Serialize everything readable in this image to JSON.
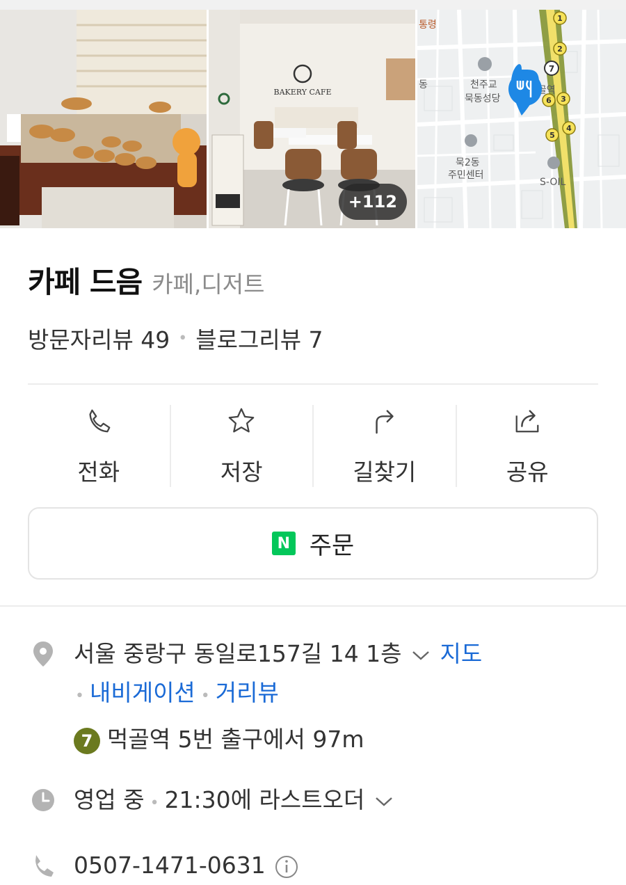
{
  "gallery": {
    "photo2_sign": "BAKERY CAFE",
    "more_count": "+112",
    "map": {
      "labels": [
        "통령",
        "천주교",
        "묵동성당",
        "먹골역",
        "동",
        "묵2동",
        "주민센터",
        "S-OIL"
      ],
      "subway_exits": [
        "1",
        "2",
        "7",
        "6",
        "3",
        "5",
        "4"
      ]
    }
  },
  "place": {
    "name": "카페 드음",
    "category": "카페,디저트",
    "visitor_reviews": "방문자리뷰 49",
    "blog_reviews": "블로그리뷰 7"
  },
  "actions": [
    {
      "label": "전화",
      "icon": "phone-icon"
    },
    {
      "label": "저장",
      "icon": "star-icon"
    },
    {
      "label": "길찾기",
      "icon": "directions-icon"
    },
    {
      "label": "공유",
      "icon": "share-icon"
    }
  ],
  "order": {
    "label": "주문",
    "logo": "N"
  },
  "info": {
    "address": "서울 중랑구 동일로157길 14 1층",
    "map_link": "지도",
    "navigation_link": "내비게이션",
    "street_view_link": "거리뷰",
    "subway_line": "7",
    "subway_text": "먹골역 5번 출구에서 97m",
    "hours_status": "영업 중",
    "hours_detail": "21:30에 라스트오더",
    "phone": "0507-1471-0631"
  },
  "colors": {
    "link": "#1a6ad6",
    "naver_green": "#03c75a",
    "line7": "#6b7a1f",
    "map_pin": "#1e88e5"
  }
}
